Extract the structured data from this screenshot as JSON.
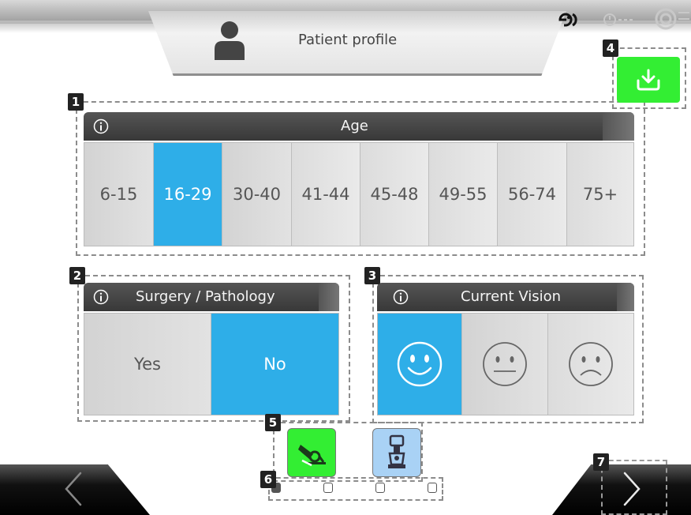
{
  "header": {
    "title": "Patient profile",
    "profile_icon": "person-icon",
    "status_icons": [
      "connection-icon",
      "timer-icon",
      "settings-target-icon"
    ]
  },
  "callouts": [
    "1",
    "2",
    "3",
    "4",
    "5",
    "6",
    "7"
  ],
  "download": {
    "icon": "download-icon",
    "color": "#33ee33"
  },
  "age": {
    "title": "Age",
    "info_icon": "info-icon",
    "options": [
      "6-15",
      "16-29",
      "30-40",
      "41-44",
      "45-48",
      "49-55",
      "56-74",
      "75+"
    ],
    "selected": "16-29"
  },
  "surgery": {
    "title": "Surgery / Pathology",
    "options": [
      "Yes",
      "No"
    ],
    "selected": "No"
  },
  "vision": {
    "title": "Current Vision",
    "options": [
      "happy-face-icon",
      "neutral-face-icon",
      "sad-face-icon"
    ],
    "selected": "happy-face-icon"
  },
  "modes": [
    {
      "icon": "microscope-icon",
      "color": "#33ee33"
    },
    {
      "icon": "device-icon",
      "color": "#a9d2f5"
    }
  ],
  "pager": {
    "count": 4,
    "active": 1
  },
  "nav": {
    "back_icon": "chevron-left-icon",
    "next_icon": "chevron-right-icon"
  },
  "colors": {
    "accent": "#2eaee8",
    "green": "#33ee33",
    "header": "#444444"
  }
}
